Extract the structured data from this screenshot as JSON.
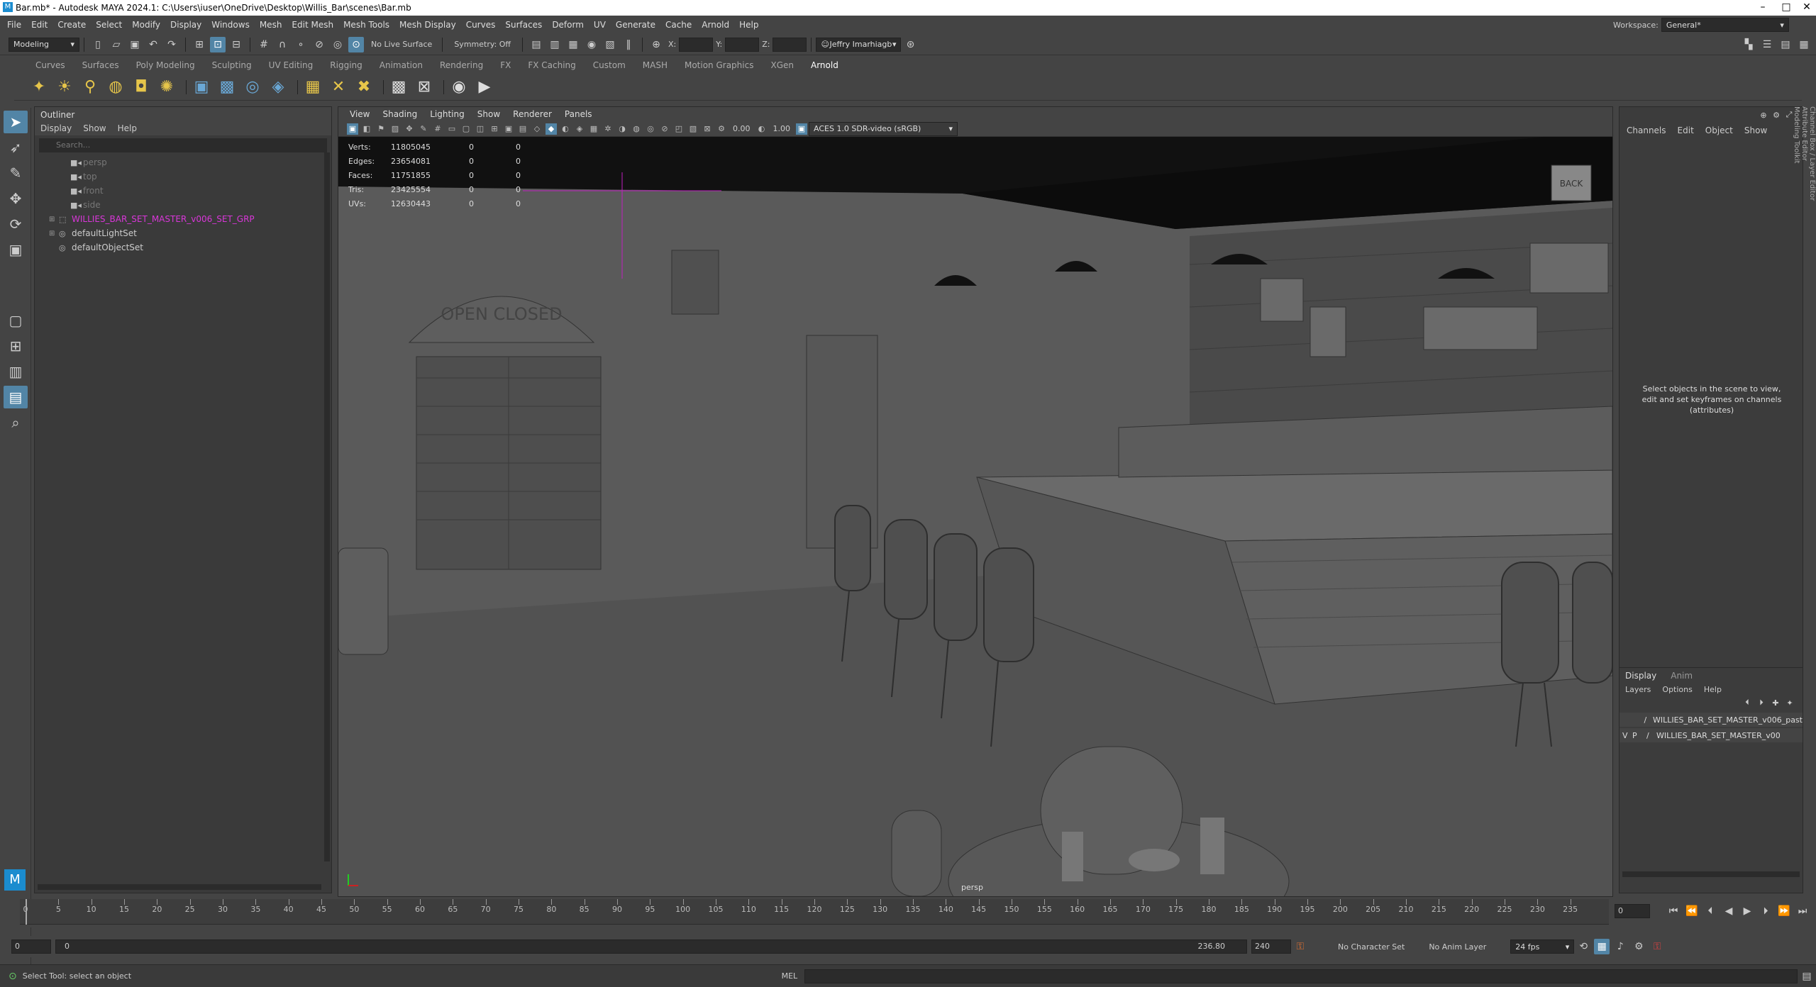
{
  "window": {
    "title": "Bar.mb* - Autodesk MAYA 2024.1: C:\\Users\\iuser\\OneDrive\\Desktop\\Willis_Bar\\scenes\\Bar.mb",
    "controls": [
      "–",
      "□",
      "✕"
    ]
  },
  "menubar": [
    "File",
    "Edit",
    "Create",
    "Select",
    "Modify",
    "Display",
    "Windows",
    "Mesh",
    "Edit Mesh",
    "Mesh Tools",
    "Mesh Display",
    "Curves",
    "Surfaces",
    "Deform",
    "UV",
    "Generate",
    "Cache",
    "Arnold",
    "Help"
  ],
  "workspace": {
    "label": "Workspace:",
    "value": "General*"
  },
  "statusline": {
    "mode": "Modeling",
    "live_surface": "No Live Surface",
    "symmetry": "Symmetry: Off",
    "x_label": "X:",
    "y_label": "Y:",
    "z_label": "Z:",
    "user": "Jeffry Imarhiagb"
  },
  "shelf_tabs": [
    "Curves",
    "Surfaces",
    "Poly Modeling",
    "Sculpting",
    "UV Editing",
    "Rigging",
    "Animation",
    "Rendering",
    "FX",
    "FX Caching",
    "Custom",
    "MASH",
    "Motion Graphics",
    "XGen",
    "Arnold"
  ],
  "shelf_active": "Arnold",
  "outliner": {
    "title": "Outliner",
    "menu": [
      "Display",
      "Show",
      "Help"
    ],
    "search_placeholder": "Search...",
    "items": [
      {
        "label": "persp",
        "style": "dim"
      },
      {
        "label": "top",
        "style": "dim"
      },
      {
        "label": "front",
        "style": "dim"
      },
      {
        "label": "side",
        "style": "dim"
      },
      {
        "label": "WILLIES_BAR_SET_MASTER_v006_SET_GRP",
        "style": "mag"
      },
      {
        "label": "defaultLightSet",
        "style": "normal"
      },
      {
        "label": "defaultObjectSet",
        "style": "normal"
      }
    ]
  },
  "viewport": {
    "menu": [
      "View",
      "Shading",
      "Lighting",
      "Show",
      "Renderer",
      "Panels"
    ],
    "exposure": "0.00",
    "gamma": "1.00",
    "color_space": "ACES 1.0 SDR-video (sRGB)",
    "camera": "persp",
    "hud": [
      {
        "label": "Verts:",
        "value": "11805045",
        "sel": "0",
        "comp": "0"
      },
      {
        "label": "Edges:",
        "value": "23654081",
        "sel": "0",
        "comp": "0"
      },
      {
        "label": "Faces:",
        "value": "11751855",
        "sel": "0",
        "comp": "0"
      },
      {
        "label": "Tris:",
        "value": "23425554",
        "sel": "0",
        "comp": "0"
      },
      {
        "label": "UVs:",
        "value": "12630443",
        "sel": "0",
        "comp": "0"
      }
    ],
    "sign_text": "OPEN CLOSED",
    "back_sign": "BACK"
  },
  "channelbox": {
    "menu": [
      "Channels",
      "Edit",
      "Object",
      "Show"
    ],
    "hint": "Select objects in the scene to view, edit and set keyframes on channels (attributes)",
    "side_tabs": [
      "Channel Box / Layer Editor",
      "Attribute Editor",
      "Modeling Toolkit"
    ]
  },
  "layers": {
    "tabs": [
      "Display",
      "Anim"
    ],
    "menu": [
      "Layers",
      "Options",
      "Help"
    ],
    "items": [
      {
        "v": "",
        "p": "",
        "label": "WILLIES_BAR_SET_MASTER_v006_past"
      },
      {
        "v": "V",
        "p": "P",
        "label": "WILLIES_BAR_SET_MASTER_v00"
      }
    ]
  },
  "timeline": {
    "ticks": [
      0,
      5,
      10,
      15,
      20,
      25,
      30,
      35,
      40,
      45,
      50,
      55,
      60,
      65,
      70,
      75,
      80,
      85,
      90,
      95,
      100,
      105,
      110,
      115,
      120,
      125,
      130,
      135,
      140,
      145,
      150,
      155,
      160,
      165,
      170,
      175,
      180,
      185,
      190,
      195,
      200,
      205,
      210,
      215,
      220,
      225,
      230,
      235
    ],
    "current_frame": "0"
  },
  "range": {
    "start": "0",
    "anim_start": "0",
    "anim_end": "236.80",
    "end": "240",
    "character_set": "No Character Set",
    "anim_layer": "No Anim Layer",
    "fps": "24 fps"
  },
  "cmdline": {
    "help": "Select Tool: select an object",
    "lang": "MEL"
  },
  "colors": {
    "accent": "#5285a6",
    "magenta": "#d936d9",
    "bg": "#444444"
  }
}
